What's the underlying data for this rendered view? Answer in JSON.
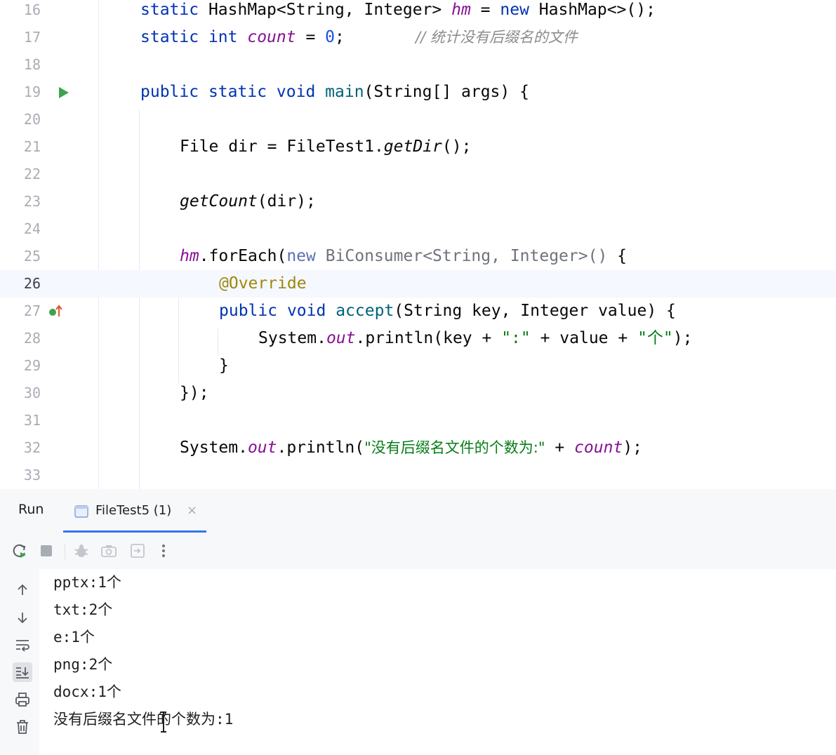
{
  "editor": {
    "line_numbers": [
      "16",
      "17",
      "18",
      "19",
      "20",
      "21",
      "22",
      "23",
      "24",
      "25",
      "26",
      "27",
      "28",
      "29",
      "30",
      "31",
      "32",
      "33"
    ],
    "current_line": "26",
    "l16": {
      "kw1": "static",
      "t1": " HashMap<String, Integer> ",
      "f1": "hm",
      "t2": " = ",
      "kw2": "new",
      "t3": " HashMap<>();"
    },
    "l17": {
      "kw1": "static",
      "t1": " ",
      "kw2": "int",
      "t2": " ",
      "f1": "count",
      "t3": " = ",
      "n1": "0",
      "t4": ";",
      "comment": "// 统计没有后缀名的文件"
    },
    "l19": {
      "kw1": "public",
      "t1": " ",
      "kw2": "static",
      "t2": " ",
      "kw3": "void",
      "t3": " ",
      "fn1": "main",
      "t4": "(String[] args) {"
    },
    "l21": {
      "t1": "File dir = FileTest1.",
      "i1": "getDir",
      "t2": "();"
    },
    "l23": {
      "i1": "getCount",
      "t1": "(dir);"
    },
    "l25": {
      "f1": "hm",
      "t1": ".forEach(",
      "kw1": "new",
      "t2": " BiConsumer<String, Integer>()",
      "t3": " {"
    },
    "l26": {
      "a1": "@Override"
    },
    "l27": {
      "kw1": "public",
      "t1": " ",
      "kw2": "void",
      "t2": " ",
      "fn1": "accept",
      "t3": "(String key, Integer value) {"
    },
    "l28": {
      "t1": "System.",
      "f1": "out",
      "t2": ".println(key + ",
      "s1": "\":\"",
      "t3": " + value + ",
      "s2": "\"个\"",
      "t4": ");"
    },
    "l29": {
      "t1": "}"
    },
    "l30": {
      "t1": "});"
    },
    "l32": {
      "t1": "System.",
      "f1": "out",
      "t2": ".println(",
      "s1": "\"没有后缀名文件的个数为:\"",
      "t3": " + ",
      "f2": "count",
      "t4": ");"
    }
  },
  "run_panel": {
    "title": "Run",
    "tab_label": "FileTest5 (1)",
    "tab_close": "×",
    "output": [
      "pptx:1个",
      "txt:2个",
      "e:1个",
      "png:2个",
      "docx:1个",
      "没有后缀名文件的个数为:1"
    ]
  },
  "colors": {
    "keyword": "#0033b3",
    "method": "#00627a",
    "field": "#871094",
    "number": "#1750eb",
    "string": "#067d17",
    "comment": "#8c8c8c",
    "annotation": "#9e880d",
    "run_arrow": "#3fa34d",
    "tab_underline": "#3574f0"
  },
  "icons": {
    "line19": "run-arrow-icon",
    "line27": "implements-override-icon",
    "toolbar": [
      "rerun-icon",
      "stop-icon",
      "debug-icon",
      "screenshot-icon",
      "restore-layout-icon",
      "more-icon"
    ],
    "sidebar": [
      "scroll-up-icon",
      "scroll-down-icon",
      "soft-wrap-icon",
      "scroll-to-end-icon",
      "print-icon",
      "trash-icon"
    ]
  }
}
